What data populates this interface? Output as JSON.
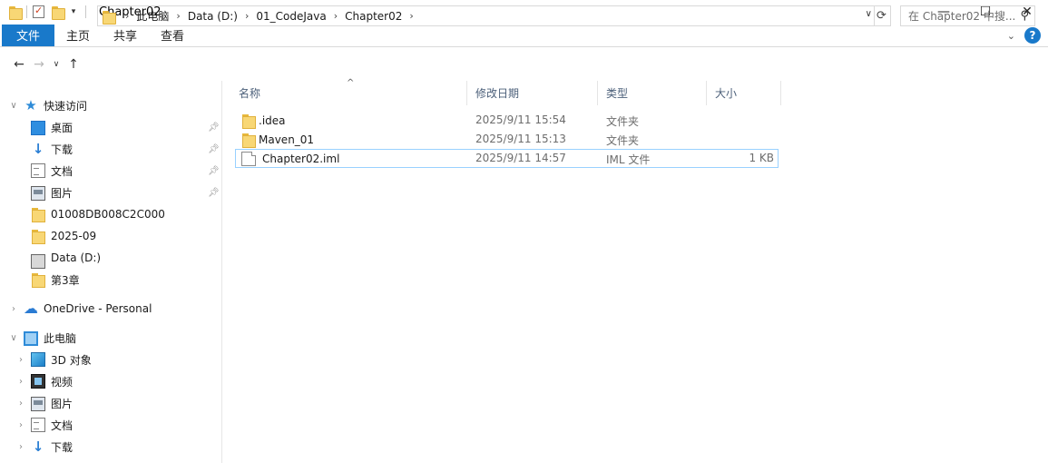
{
  "window": {
    "title": "Chapter02"
  },
  "ribbon": {
    "tabs": [
      "文件",
      "主页",
      "共享",
      "查看"
    ]
  },
  "window_controls": {
    "minimize": "—",
    "maximize": "☐",
    "close": "✕"
  },
  "address": {
    "crumbs": [
      "此电脑",
      "Data (D:)",
      "01_CodeJava",
      "Chapter02"
    ],
    "search_placeholder": "在 Chapter02 中搜..."
  },
  "nav": {
    "quick_access": "快速访问",
    "pinned": [
      {
        "label": "桌面",
        "icon": "desktop-icon"
      },
      {
        "label": "下载",
        "icon": "download-icon"
      },
      {
        "label": "文档",
        "icon": "documents-icon"
      },
      {
        "label": "图片",
        "icon": "pictures-icon"
      }
    ],
    "recent": [
      {
        "label": "01008DB008C2C000",
        "icon": "folder-icon"
      },
      {
        "label": "2025-09",
        "icon": "folder-icon"
      },
      {
        "label": "Data (D:)",
        "icon": "drive-icon"
      },
      {
        "label": "第3章",
        "icon": "folder-icon"
      }
    ],
    "onedrive": "OneDrive - Personal",
    "this_pc": "此电脑",
    "pc_items": [
      {
        "label": "3D 对象",
        "icon": "3d-objects-icon"
      },
      {
        "label": "视频",
        "icon": "video-icon"
      },
      {
        "label": "图片",
        "icon": "pictures-icon"
      },
      {
        "label": "文档",
        "icon": "documents-icon"
      },
      {
        "label": "下载",
        "icon": "download-icon"
      }
    ]
  },
  "columns": {
    "name": "名称",
    "date": "修改日期",
    "type": "类型",
    "size": "大小"
  },
  "files": [
    {
      "name": ".idea",
      "date": "2025/9/11 15:54",
      "type": "文件夹",
      "size": "",
      "icon": "folder-icon"
    },
    {
      "name": "Maven_01",
      "date": "2025/9/11 15:13",
      "type": "文件夹",
      "size": "",
      "icon": "folder-icon"
    },
    {
      "name": "Chapter02.iml",
      "date": "2025/9/11 14:57",
      "type": "IML 文件",
      "size": "1 KB",
      "icon": "file-icon"
    }
  ],
  "colors": {
    "accent": "#1979ca",
    "selection_border": "#99d1ff",
    "folder": "#f8d775"
  }
}
